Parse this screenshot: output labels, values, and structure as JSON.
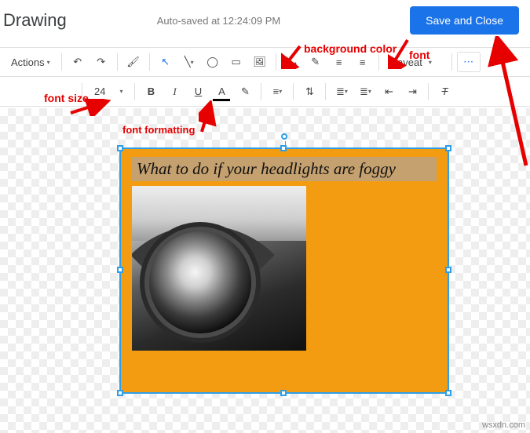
{
  "header": {
    "title": "Drawing",
    "autosave": "Auto-saved at 12:24:09 PM",
    "save_label": "Save and Close"
  },
  "toolbar": {
    "actions_label": "Actions",
    "font_name": "Caveat",
    "font_size": "24"
  },
  "canvas": {
    "textbox_content": "What to do if your headlights are foggy"
  },
  "annotations": {
    "bg_color": "background color",
    "font": "font",
    "font_size": "font size",
    "font_formatting": "font formatting"
  },
  "watermark": "wsxdn.com",
  "icons": {
    "undo": "↶",
    "redo": "↷",
    "paint": "🖌",
    "select": "↖",
    "line": "╲",
    "shape": "◯",
    "textbox": "▭",
    "image": "🖼",
    "fill": "▰",
    "border": "✎",
    "borderw": "≡",
    "more": "⋯",
    "bold": "B",
    "italic": "I",
    "underline": "U",
    "textcolor": "A",
    "highlight": "✎",
    "alignL": "≡",
    "lineSp": "⇅",
    "listN": "≣",
    "listB": "≣",
    "indL": "⇤",
    "indR": "⇥",
    "clear": "⊘",
    "dd": "▾"
  }
}
